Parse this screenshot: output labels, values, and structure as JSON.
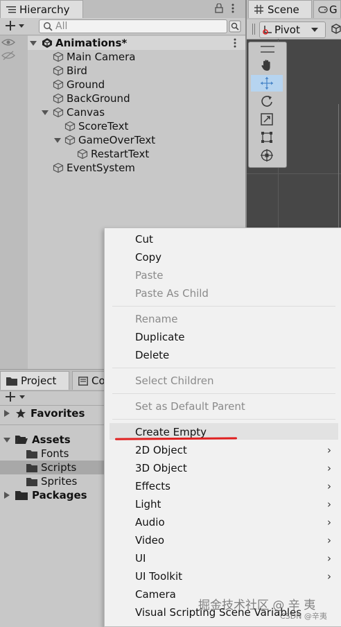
{
  "hierarchy": {
    "tab_label": "Hierarchy",
    "search_placeholder": "All",
    "scene_name": "Animations*",
    "items": [
      {
        "label": "Main Camera"
      },
      {
        "label": "Bird"
      },
      {
        "label": "Ground"
      },
      {
        "label": "BackGround"
      },
      {
        "label": "Canvas"
      },
      {
        "label": "ScoreText"
      },
      {
        "label": "GameOverText"
      },
      {
        "label": "RestartText"
      },
      {
        "label": "EventSystem"
      }
    ]
  },
  "scene_tab": {
    "label": "Scene",
    "second_tab_label": "G",
    "pivot_label": "Pivot"
  },
  "project": {
    "tab_label": "Project",
    "second_tab_label": "Co",
    "favorites_label": "Favorites",
    "assets_label": "Assets",
    "folders": [
      "Fonts",
      "Scripts",
      "Sprites"
    ],
    "packages_label": "Packages"
  },
  "context_menu": {
    "cut": "Cut",
    "copy": "Copy",
    "paste": "Paste",
    "paste_as_child": "Paste As Child",
    "rename": "Rename",
    "duplicate": "Duplicate",
    "delete": "Delete",
    "select_children": "Select Children",
    "set_default_parent": "Set as Default Parent",
    "create_empty": "Create Empty",
    "object_2d": "2D Object",
    "object_3d": "3D Object",
    "effects": "Effects",
    "light": "Light",
    "audio": "Audio",
    "video": "Video",
    "ui": "UI",
    "ui_toolkit": "UI Toolkit",
    "camera": "Camera",
    "visual_scripting": "Visual Scripting Scene Variables"
  },
  "watermark": {
    "main": "掘金技术社区 @ 辛 夷",
    "sub": "CSDN @辛夷"
  },
  "colors": {
    "selection": "#a8a8a8",
    "tool_active": "#b6d4f0",
    "annotation_underline": "#e02020"
  }
}
